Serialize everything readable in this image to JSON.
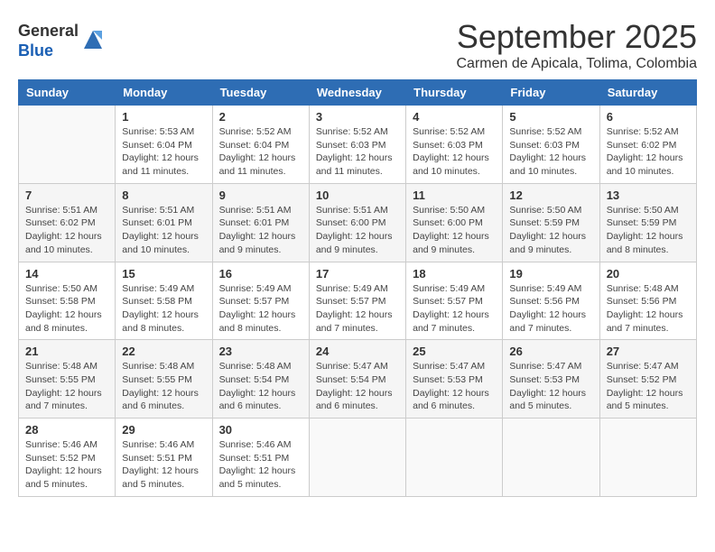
{
  "logo": {
    "general": "General",
    "blue": "Blue"
  },
  "title": "September 2025",
  "subtitle": "Carmen de Apicala, Tolima, Colombia",
  "days_of_week": [
    "Sunday",
    "Monday",
    "Tuesday",
    "Wednesday",
    "Thursday",
    "Friday",
    "Saturday"
  ],
  "weeks": [
    [
      {
        "day": "",
        "info": ""
      },
      {
        "day": "1",
        "info": "Sunrise: 5:53 AM\nSunset: 6:04 PM\nDaylight: 12 hours\nand 11 minutes."
      },
      {
        "day": "2",
        "info": "Sunrise: 5:52 AM\nSunset: 6:04 PM\nDaylight: 12 hours\nand 11 minutes."
      },
      {
        "day": "3",
        "info": "Sunrise: 5:52 AM\nSunset: 6:03 PM\nDaylight: 12 hours\nand 11 minutes."
      },
      {
        "day": "4",
        "info": "Sunrise: 5:52 AM\nSunset: 6:03 PM\nDaylight: 12 hours\nand 10 minutes."
      },
      {
        "day": "5",
        "info": "Sunrise: 5:52 AM\nSunset: 6:03 PM\nDaylight: 12 hours\nand 10 minutes."
      },
      {
        "day": "6",
        "info": "Sunrise: 5:52 AM\nSunset: 6:02 PM\nDaylight: 12 hours\nand 10 minutes."
      }
    ],
    [
      {
        "day": "7",
        "info": "Sunrise: 5:51 AM\nSunset: 6:02 PM\nDaylight: 12 hours\nand 10 minutes."
      },
      {
        "day": "8",
        "info": "Sunrise: 5:51 AM\nSunset: 6:01 PM\nDaylight: 12 hours\nand 10 minutes."
      },
      {
        "day": "9",
        "info": "Sunrise: 5:51 AM\nSunset: 6:01 PM\nDaylight: 12 hours\nand 9 minutes."
      },
      {
        "day": "10",
        "info": "Sunrise: 5:51 AM\nSunset: 6:00 PM\nDaylight: 12 hours\nand 9 minutes."
      },
      {
        "day": "11",
        "info": "Sunrise: 5:50 AM\nSunset: 6:00 PM\nDaylight: 12 hours\nand 9 minutes."
      },
      {
        "day": "12",
        "info": "Sunrise: 5:50 AM\nSunset: 5:59 PM\nDaylight: 12 hours\nand 9 minutes."
      },
      {
        "day": "13",
        "info": "Sunrise: 5:50 AM\nSunset: 5:59 PM\nDaylight: 12 hours\nand 8 minutes."
      }
    ],
    [
      {
        "day": "14",
        "info": "Sunrise: 5:50 AM\nSunset: 5:58 PM\nDaylight: 12 hours\nand 8 minutes."
      },
      {
        "day": "15",
        "info": "Sunrise: 5:49 AM\nSunset: 5:58 PM\nDaylight: 12 hours\nand 8 minutes."
      },
      {
        "day": "16",
        "info": "Sunrise: 5:49 AM\nSunset: 5:57 PM\nDaylight: 12 hours\nand 8 minutes."
      },
      {
        "day": "17",
        "info": "Sunrise: 5:49 AM\nSunset: 5:57 PM\nDaylight: 12 hours\nand 7 minutes."
      },
      {
        "day": "18",
        "info": "Sunrise: 5:49 AM\nSunset: 5:57 PM\nDaylight: 12 hours\nand 7 minutes."
      },
      {
        "day": "19",
        "info": "Sunrise: 5:49 AM\nSunset: 5:56 PM\nDaylight: 12 hours\nand 7 minutes."
      },
      {
        "day": "20",
        "info": "Sunrise: 5:48 AM\nSunset: 5:56 PM\nDaylight: 12 hours\nand 7 minutes."
      }
    ],
    [
      {
        "day": "21",
        "info": "Sunrise: 5:48 AM\nSunset: 5:55 PM\nDaylight: 12 hours\nand 7 minutes."
      },
      {
        "day": "22",
        "info": "Sunrise: 5:48 AM\nSunset: 5:55 PM\nDaylight: 12 hours\nand 6 minutes."
      },
      {
        "day": "23",
        "info": "Sunrise: 5:48 AM\nSunset: 5:54 PM\nDaylight: 12 hours\nand 6 minutes."
      },
      {
        "day": "24",
        "info": "Sunrise: 5:47 AM\nSunset: 5:54 PM\nDaylight: 12 hours\nand 6 minutes."
      },
      {
        "day": "25",
        "info": "Sunrise: 5:47 AM\nSunset: 5:53 PM\nDaylight: 12 hours\nand 6 minutes."
      },
      {
        "day": "26",
        "info": "Sunrise: 5:47 AM\nSunset: 5:53 PM\nDaylight: 12 hours\nand 5 minutes."
      },
      {
        "day": "27",
        "info": "Sunrise: 5:47 AM\nSunset: 5:52 PM\nDaylight: 12 hours\nand 5 minutes."
      }
    ],
    [
      {
        "day": "28",
        "info": "Sunrise: 5:46 AM\nSunset: 5:52 PM\nDaylight: 12 hours\nand 5 minutes."
      },
      {
        "day": "29",
        "info": "Sunrise: 5:46 AM\nSunset: 5:51 PM\nDaylight: 12 hours\nand 5 minutes."
      },
      {
        "day": "30",
        "info": "Sunrise: 5:46 AM\nSunset: 5:51 PM\nDaylight: 12 hours\nand 5 minutes."
      },
      {
        "day": "",
        "info": ""
      },
      {
        "day": "",
        "info": ""
      },
      {
        "day": "",
        "info": ""
      },
      {
        "day": "",
        "info": ""
      }
    ]
  ]
}
